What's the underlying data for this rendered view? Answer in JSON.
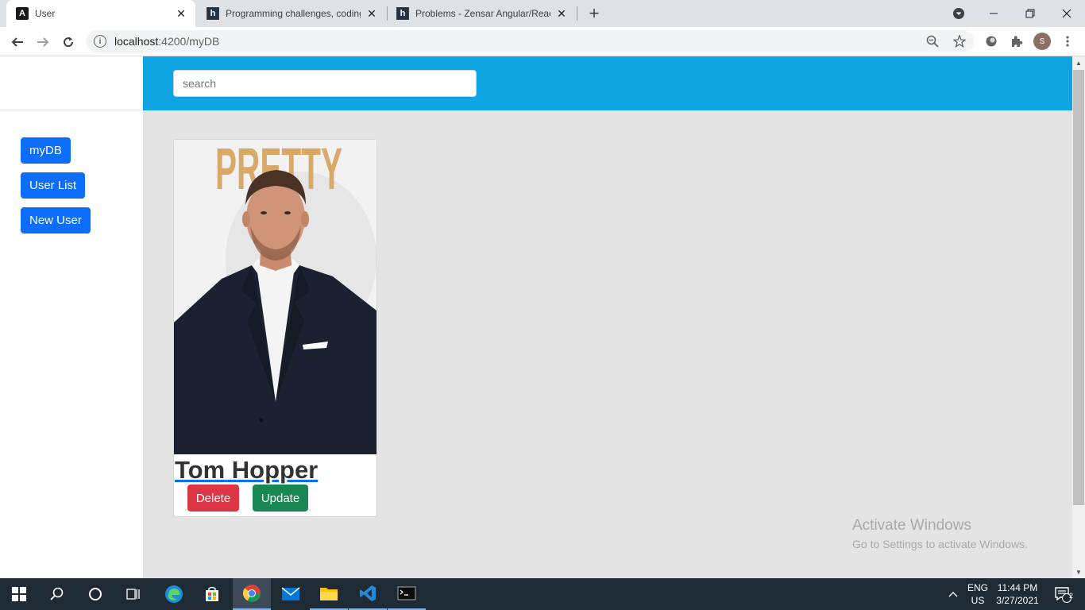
{
  "browser": {
    "tabs": [
      {
        "title": "User",
        "favicon": "angular-icon",
        "active": true
      },
      {
        "title": "Programming challenges, coding",
        "favicon": "hackerrank-icon",
        "active": false
      },
      {
        "title": "Problems - Zensar Angular/React",
        "favicon": "hackerrank-icon",
        "active": false
      }
    ],
    "new_tab": "+",
    "address": {
      "host": "localhost",
      "path": ":4200/myDB"
    },
    "profile_initial": "S"
  },
  "app": {
    "search_placeholder": "search",
    "nav": [
      {
        "label": "myDB"
      },
      {
        "label": "User List"
      },
      {
        "label": "New User"
      }
    ],
    "card": {
      "name": "Tom Hopper",
      "photo_sign_text": "PRETTY",
      "delete_label": "Delete",
      "update_label": "Update"
    }
  },
  "watermark": {
    "line1": "Activate Windows",
    "line2": "Go to Settings to activate Windows."
  },
  "taskbar": {
    "lang": "ENG",
    "region": "US",
    "time": "11:44 PM",
    "date": "3/27/2021",
    "notification_count": "2"
  },
  "colors": {
    "header": "#0ea5e2",
    "primary": "#0d6efd",
    "danger": "#dc3545",
    "success": "#198754",
    "taskbar": "#1f2b34"
  }
}
